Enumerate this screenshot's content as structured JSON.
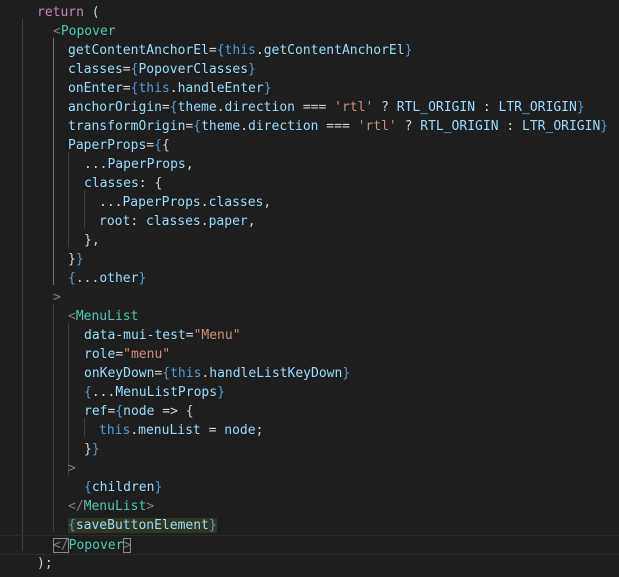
{
  "colors": {
    "background": "#1e1e1e",
    "keyword": "#c586c0",
    "tag": "#4ec9b0",
    "attribute": "#9cdcfe",
    "string": "#ce9178",
    "function": "#dcdcaa",
    "this": "#569cd6",
    "punctuation": "#808080",
    "text": "#d4d4d4",
    "highlight": "#3b4a1e"
  },
  "lines": [
    {
      "tokens": [
        [
          "kw",
          "return"
        ],
        [
          "plain",
          " ("
        ]
      ]
    },
    {
      "tokens": [
        [
          "pun",
          "<"
        ],
        [
          "tag",
          "Popover"
        ]
      ]
    },
    {
      "tokens": [
        [
          "attr",
          "getContentAnchorEl"
        ],
        [
          "plain",
          "="
        ],
        [
          "brace",
          "{"
        ],
        [
          "this",
          "this"
        ],
        [
          "plain",
          "."
        ],
        [
          "attr",
          "getContentAnchorEl"
        ],
        [
          "brace",
          "}"
        ]
      ]
    },
    {
      "tokens": [
        [
          "attr",
          "classes"
        ],
        [
          "plain",
          "="
        ],
        [
          "brace",
          "{"
        ],
        [
          "ident",
          "PopoverClasses"
        ],
        [
          "brace",
          "}"
        ]
      ]
    },
    {
      "tokens": [
        [
          "attr",
          "onEnter"
        ],
        [
          "plain",
          "="
        ],
        [
          "brace",
          "{"
        ],
        [
          "this",
          "this"
        ],
        [
          "plain",
          "."
        ],
        [
          "attr",
          "handleEnter"
        ],
        [
          "brace",
          "}"
        ]
      ]
    },
    {
      "tokens": [
        [
          "attr",
          "anchorOrigin"
        ],
        [
          "plain",
          "="
        ],
        [
          "brace",
          "{"
        ],
        [
          "ident",
          "theme"
        ],
        [
          "plain",
          "."
        ],
        [
          "ident",
          "direction"
        ],
        [
          "plain",
          " === "
        ],
        [
          "str",
          "'rtl'"
        ],
        [
          "plain",
          " ? "
        ],
        [
          "ident",
          "RTL_ORIGIN"
        ],
        [
          "plain",
          " : "
        ],
        [
          "ident",
          "LTR_ORIGIN"
        ],
        [
          "brace",
          "}"
        ]
      ]
    },
    {
      "tokens": [
        [
          "attr",
          "transformOrigin"
        ],
        [
          "plain",
          "="
        ],
        [
          "brace",
          "{"
        ],
        [
          "ident",
          "theme"
        ],
        [
          "plain",
          "."
        ],
        [
          "ident",
          "direction"
        ],
        [
          "plain",
          " === "
        ],
        [
          "str",
          "'rtl'"
        ],
        [
          "plain",
          " ? "
        ],
        [
          "ident",
          "RTL_ORIGIN"
        ],
        [
          "plain",
          " : "
        ],
        [
          "ident",
          "LTR_ORIGIN"
        ],
        [
          "brace",
          "}"
        ]
      ]
    },
    {
      "tokens": [
        [
          "attr",
          "PaperProps"
        ],
        [
          "plain",
          "="
        ],
        [
          "brace",
          "{"
        ],
        [
          "plain",
          "{"
        ]
      ]
    },
    {
      "tokens": [
        [
          "plain",
          "..."
        ],
        [
          "ident",
          "PaperProps"
        ],
        [
          "plain",
          ","
        ]
      ]
    },
    {
      "tokens": [
        [
          "ident",
          "classes"
        ],
        [
          "plain",
          ": {"
        ]
      ]
    },
    {
      "tokens": [
        [
          "plain",
          "..."
        ],
        [
          "ident",
          "PaperProps"
        ],
        [
          "plain",
          "."
        ],
        [
          "ident",
          "classes"
        ],
        [
          "plain",
          ","
        ]
      ]
    },
    {
      "tokens": [
        [
          "ident",
          "root"
        ],
        [
          "plain",
          ": "
        ],
        [
          "ident",
          "classes"
        ],
        [
          "plain",
          "."
        ],
        [
          "ident",
          "paper"
        ],
        [
          "plain",
          ","
        ]
      ]
    },
    {
      "tokens": [
        [
          "plain",
          "},"
        ]
      ]
    },
    {
      "tokens": [
        [
          "plain",
          "}"
        ],
        [
          "brace",
          "}"
        ]
      ]
    },
    {
      "tokens": [
        [
          "brace",
          "{"
        ],
        [
          "plain",
          "..."
        ],
        [
          "ident",
          "other"
        ],
        [
          "brace",
          "}"
        ]
      ]
    },
    {
      "tokens": [
        [
          "pun",
          ">"
        ]
      ]
    },
    {
      "tokens": [
        [
          "pun",
          "<"
        ],
        [
          "tag",
          "MenuList"
        ]
      ]
    },
    {
      "tokens": [
        [
          "attr",
          "data-mui-test"
        ],
        [
          "plain",
          "="
        ],
        [
          "str",
          "\"Menu\""
        ]
      ]
    },
    {
      "tokens": [
        [
          "attr",
          "role"
        ],
        [
          "plain",
          "="
        ],
        [
          "str",
          "\"menu\""
        ]
      ]
    },
    {
      "tokens": [
        [
          "attr",
          "onKeyDown"
        ],
        [
          "plain",
          "="
        ],
        [
          "brace",
          "{"
        ],
        [
          "this",
          "this"
        ],
        [
          "plain",
          "."
        ],
        [
          "attr",
          "handleListKeyDown"
        ],
        [
          "brace",
          "}"
        ]
      ]
    },
    {
      "tokens": [
        [
          "brace",
          "{"
        ],
        [
          "plain",
          "..."
        ],
        [
          "ident",
          "MenuListProps"
        ],
        [
          "brace",
          "}"
        ]
      ]
    },
    {
      "tokens": [
        [
          "attr",
          "ref"
        ],
        [
          "plain",
          "="
        ],
        [
          "brace",
          "{"
        ],
        [
          "ident",
          "node"
        ],
        [
          "plain",
          " => {"
        ]
      ]
    },
    {
      "tokens": [
        [
          "this",
          "this"
        ],
        [
          "plain",
          "."
        ],
        [
          "ident",
          "menuList"
        ],
        [
          "plain",
          " = "
        ],
        [
          "ident",
          "node"
        ],
        [
          "plain",
          ";"
        ]
      ]
    },
    {
      "tokens": [
        [
          "plain",
          "}"
        ],
        [
          "brace",
          "}"
        ]
      ]
    },
    {
      "tokens": [
        [
          "pun",
          ">"
        ]
      ]
    },
    {
      "tokens": [
        [
          "brace",
          "{"
        ],
        [
          "ident",
          "children"
        ],
        [
          "brace",
          "}"
        ]
      ]
    },
    {
      "tokens": [
        [
          "pun",
          "</"
        ],
        [
          "tag",
          "MenuList"
        ],
        [
          "pun",
          ">"
        ]
      ]
    },
    {
      "tokens": [
        [
          "brace",
          "{"
        ],
        [
          "ident",
          "saveButtonElement"
        ],
        [
          "brace",
          "}"
        ]
      ]
    },
    {
      "tokens": [
        [
          "pun",
          "</"
        ],
        [
          "tag",
          "Popover"
        ],
        [
          "pun",
          ">"
        ]
      ]
    },
    {
      "tokens": [
        [
          "plain",
          ");"
        ]
      ]
    }
  ]
}
